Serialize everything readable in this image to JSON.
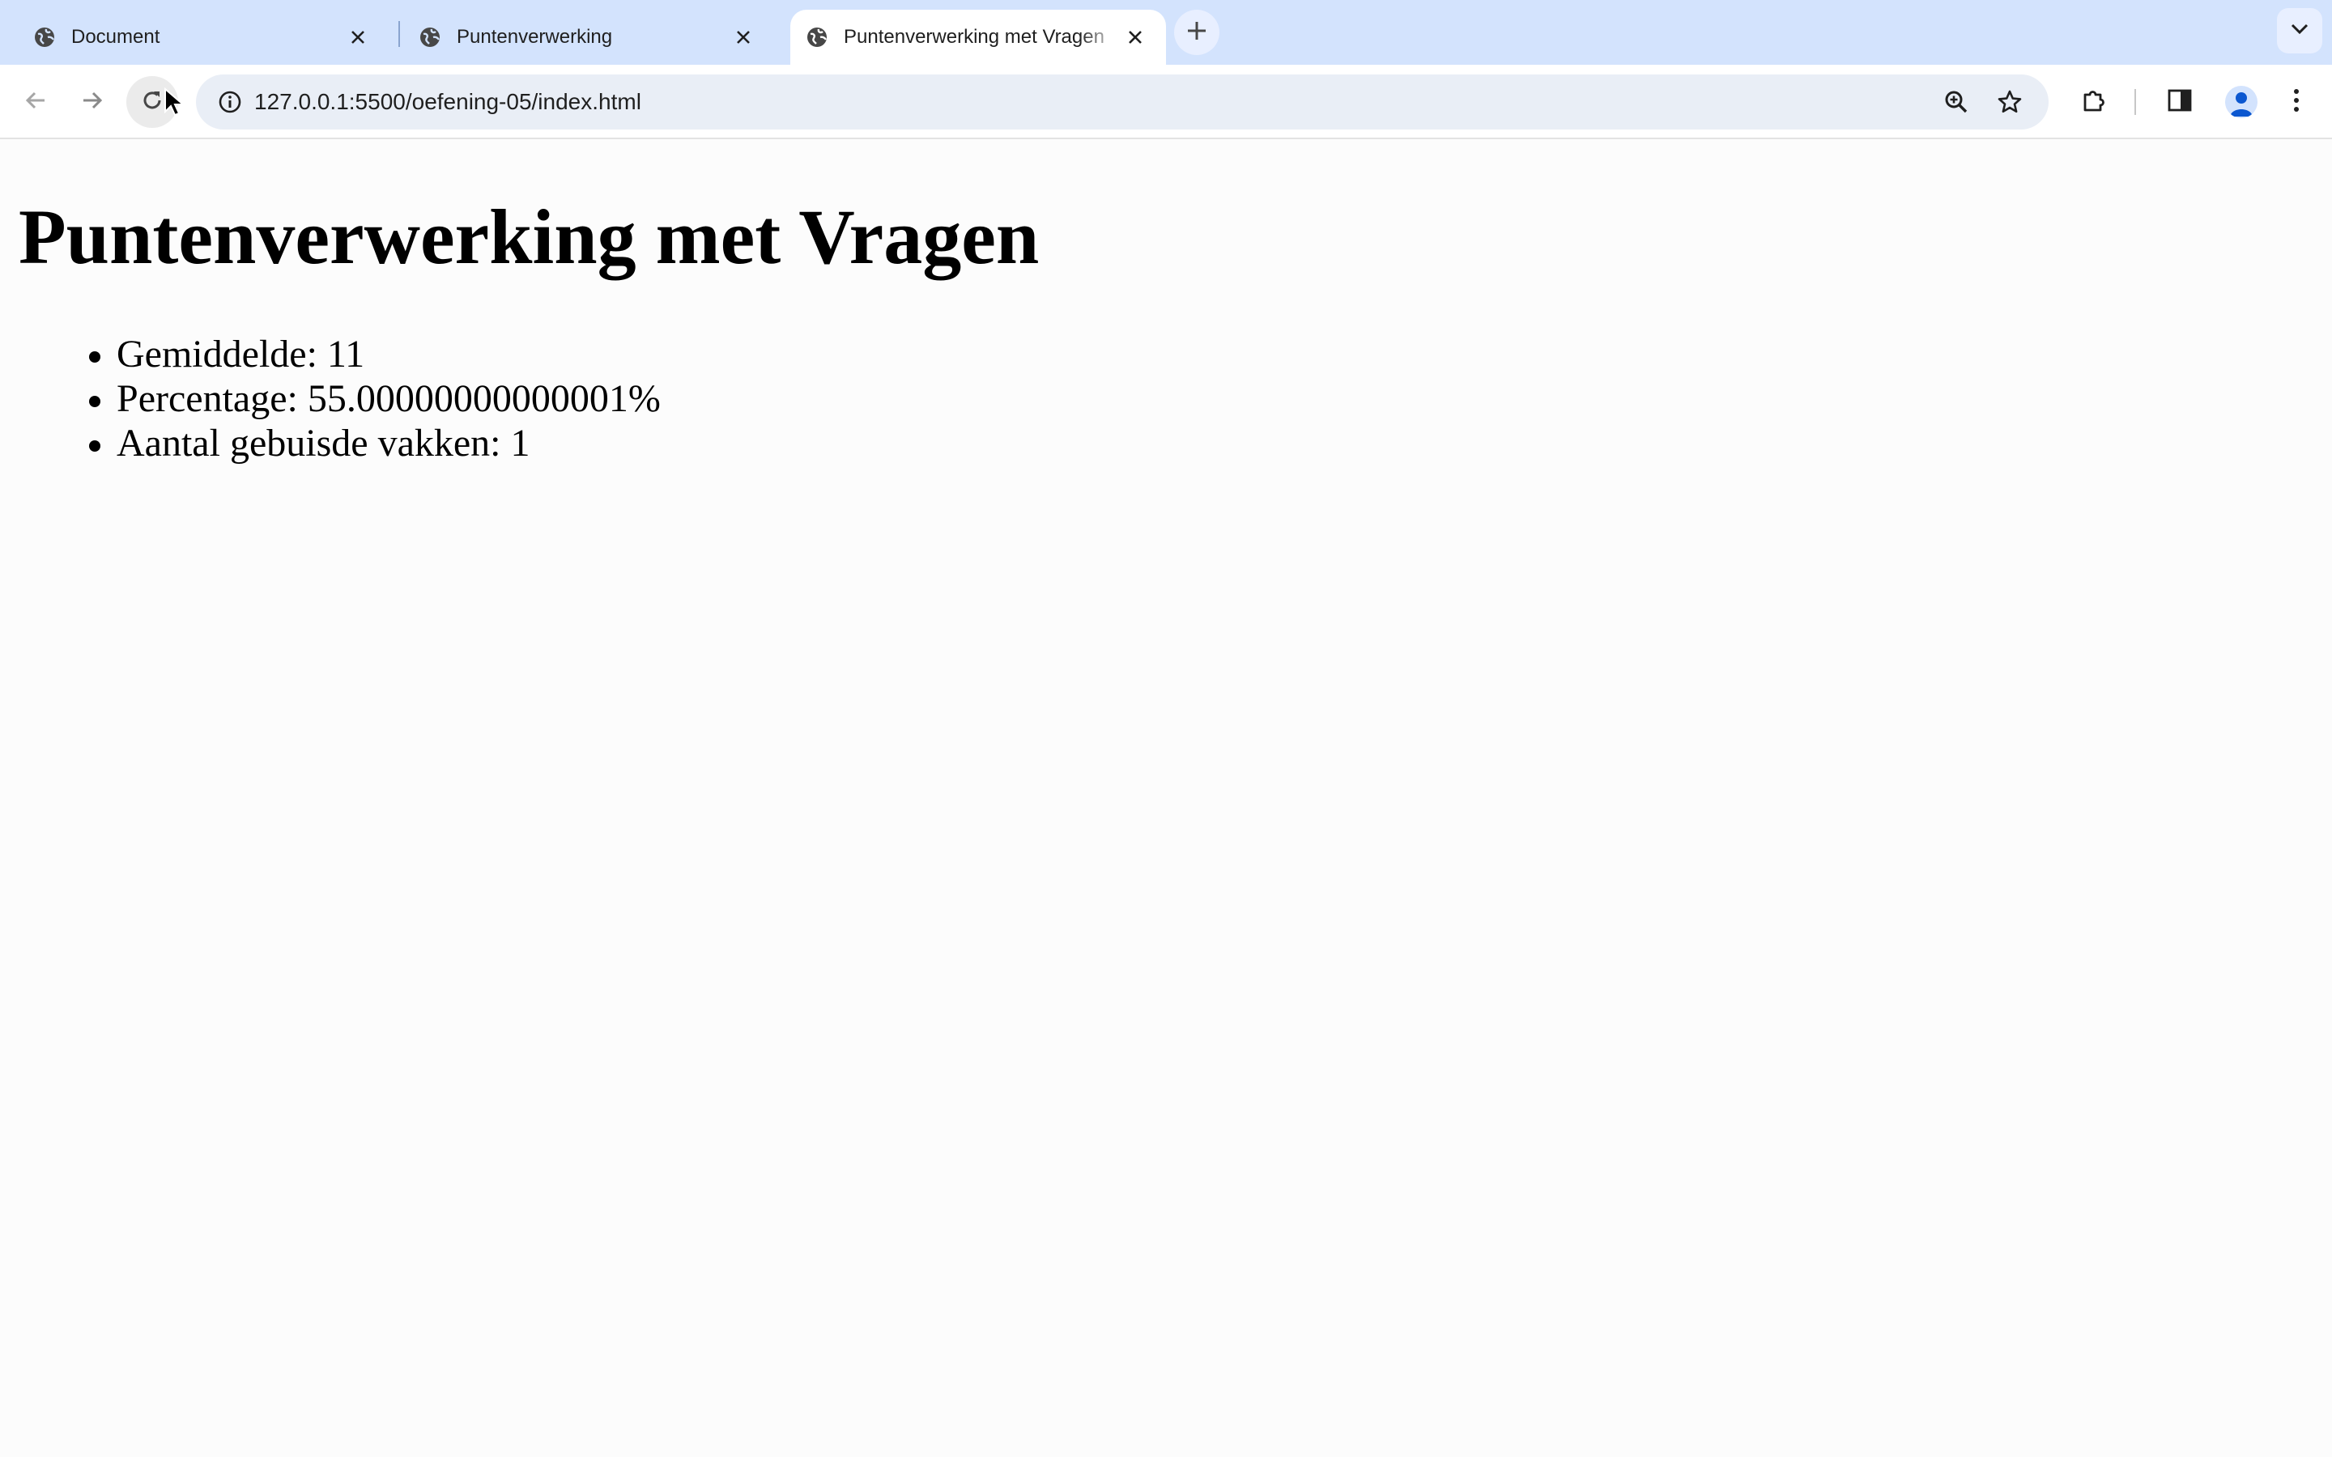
{
  "browser": {
    "tabs": [
      {
        "title": "Document",
        "active": false
      },
      {
        "title": "Puntenverwerking",
        "active": false
      },
      {
        "title": "Puntenverwerking met Vragen",
        "active": true
      }
    ],
    "address_bar": {
      "url": "127.0.0.1:5500/oefening-05/index.html"
    },
    "icons": {
      "favicon": "globe-icon",
      "close": "close-icon",
      "new_tab": "plus-icon",
      "tab_search": "chevron-down-icon",
      "back": "arrow-left-icon",
      "forward": "arrow-right-icon",
      "reload": "reload-icon",
      "site_info": "info-icon",
      "zoom": "zoom-in-icon",
      "bookmark": "star-icon",
      "extensions": "puzzle-icon",
      "side_panel": "side-panel-icon",
      "profile": "person-icon",
      "menu": "kebab-menu-icon"
    },
    "colors": {
      "tabstrip": "#d3e3fd",
      "omnibox": "#e9eef6",
      "page_background": "#fcfcfc"
    }
  },
  "page": {
    "heading": "Puntenverwerking met Vragen",
    "results": [
      "Gemiddelde: 11",
      "Percentage: 55.00000000000001%",
      "Aantal gebuisde vakken: 1"
    ]
  }
}
